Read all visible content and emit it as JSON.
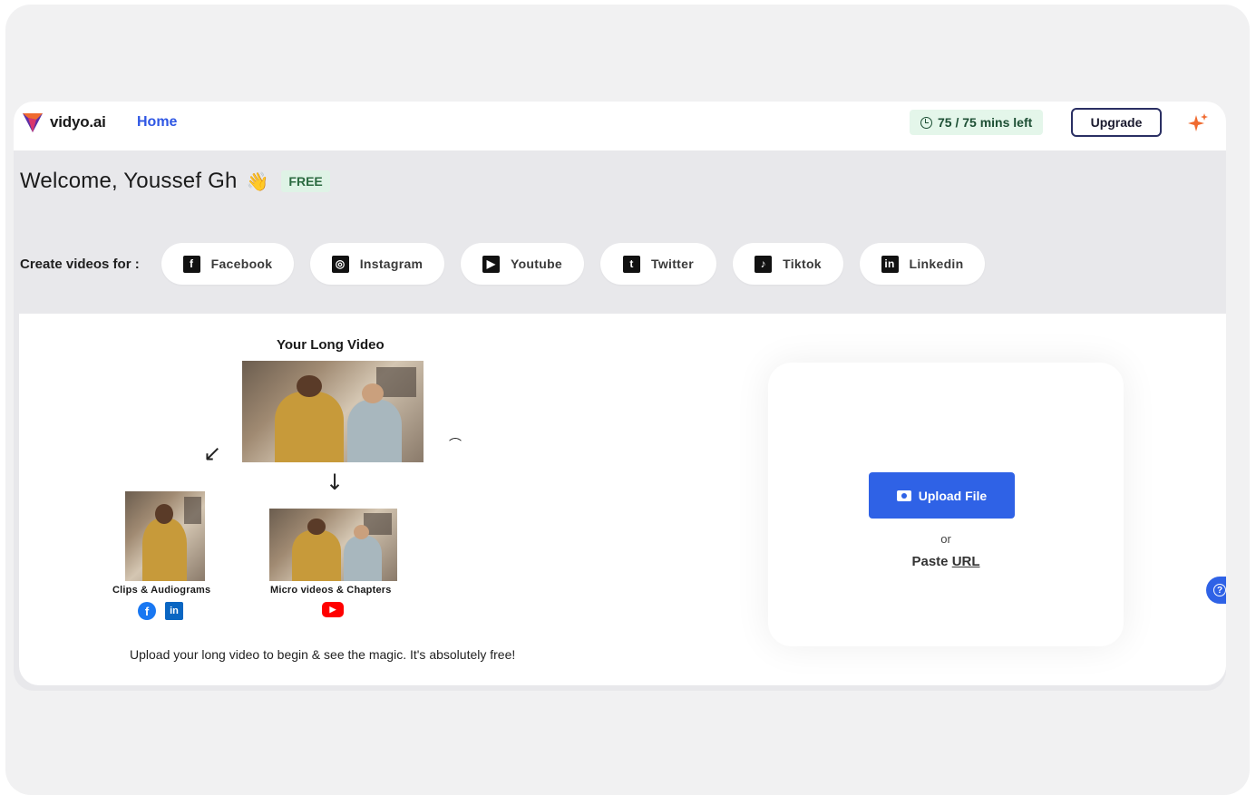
{
  "header": {
    "logo_text": "vidyo.ai",
    "nav_home": "Home",
    "minutes_left": "75 / 75 mins left",
    "upgrade_label": "Upgrade"
  },
  "welcome": {
    "greeting": "Welcome, Youssef Gh",
    "wave_emoji": "👋",
    "plan_badge": "FREE"
  },
  "create": {
    "label": "Create videos for :",
    "platforms": [
      {
        "label": "Facebook",
        "glyph": "f"
      },
      {
        "label": "Instagram",
        "glyph": "◎"
      },
      {
        "label": "Youtube",
        "glyph": "▶"
      },
      {
        "label": "Twitter",
        "glyph": "t"
      },
      {
        "label": "Tiktok",
        "glyph": "♪"
      },
      {
        "label": "Linkedin",
        "glyph": "in"
      }
    ]
  },
  "illustration": {
    "title": "Your Long Video",
    "clips_caption": "Clips & Audiograms",
    "micro_caption": "Micro videos & Chapters",
    "footer": "Upload your long video to begin & see the magic. It's absolutely free!",
    "facebook_glyph": "f",
    "linkedin_glyph": "in",
    "youtube_glyph": "▶"
  },
  "upload": {
    "button_label": "Upload File",
    "or_text": "or",
    "paste_prefix": "Paste",
    "paste_url": "URL"
  },
  "help": {
    "glyph": "?"
  },
  "colors": {
    "accent_blue": "#2f62e6",
    "home_link": "#2f57e4",
    "sparkle": "#f06a2f",
    "free_badge_bg": "#dff3e6"
  }
}
